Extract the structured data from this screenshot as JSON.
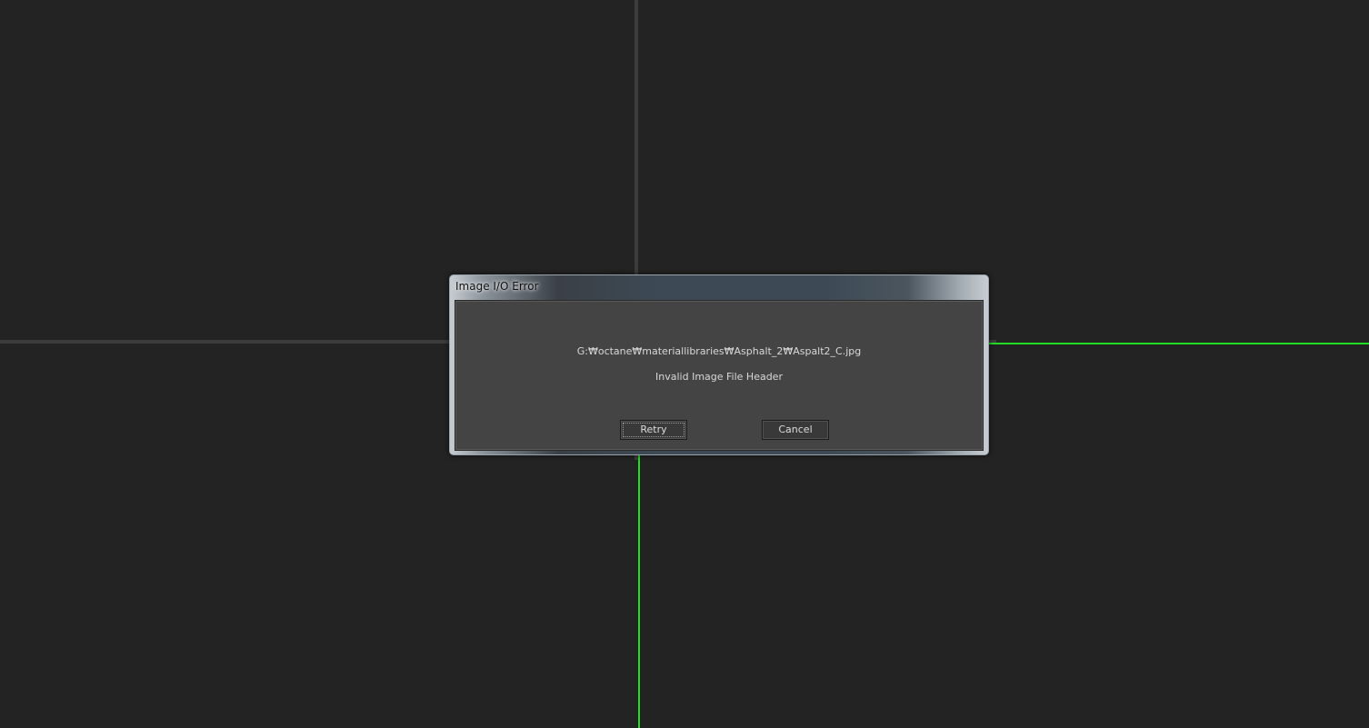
{
  "colors": {
    "background": "#232323",
    "grid_line": "#3c3c3c",
    "axis_green": "#22dd22",
    "dialog_body": "#444444"
  },
  "dialog": {
    "title": "Image I/O Error",
    "path": "G:₩octane₩materiallibraries₩Asphalt_2₩Aspalt2_C.jpg",
    "message": "Invalid Image File Header",
    "buttons": {
      "retry_label": "Retry",
      "cancel_label": "Cancel"
    }
  }
}
